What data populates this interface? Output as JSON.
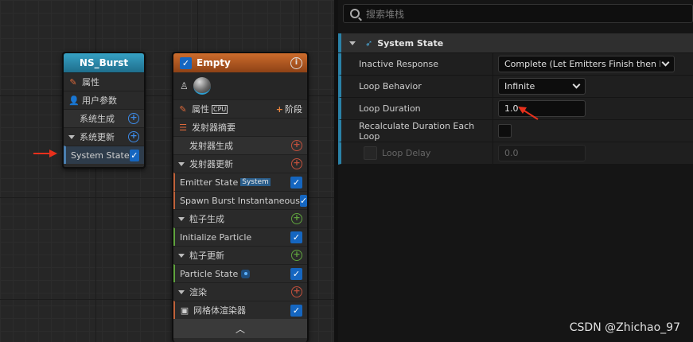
{
  "search": {
    "placeholder": "搜索堆栈"
  },
  "burst_node": {
    "title": "NS_Burst",
    "rows": {
      "properties": "属性",
      "user_params": "用户参数",
      "system_spawn": "系统生成",
      "system_update": "系统更新",
      "system_state": "System State"
    }
  },
  "emitter_node": {
    "title": "Empty",
    "rows": {
      "properties": "属性",
      "cpu": "CPU",
      "stage": "阶段",
      "summary": "发射器摘要",
      "emitter_spawn": "发射器生成",
      "emitter_update": "发射器更新",
      "emitter_state": "Emitter State",
      "emitter_state_tag": "System",
      "spawn_burst": "Spawn Burst Instantaneous",
      "particle_spawn": "粒子生成",
      "init_particle": "Initialize Particle",
      "particle_update": "粒子更新",
      "particle_state": "Particle State",
      "render": "渲染",
      "mesh_renderer": "网格体渲染器"
    }
  },
  "details": {
    "section_title": "System State",
    "props": [
      {
        "label": "Inactive Response",
        "value": "Complete (Let Emitters Finish then Kill)"
      },
      {
        "label": "Loop Behavior",
        "value": "Infinite"
      },
      {
        "label": "Loop Duration",
        "value": "1.0"
      },
      {
        "label": "Recalculate Duration Each Loop",
        "value": ""
      },
      {
        "label": "Loop Delay",
        "value": "0.0"
      }
    ]
  },
  "watermark": "CSDN @Zhichao_97",
  "colors": {
    "accent": "#2a82a8",
    "arrow": "#e8301c",
    "checkbox": "#1566c0"
  }
}
